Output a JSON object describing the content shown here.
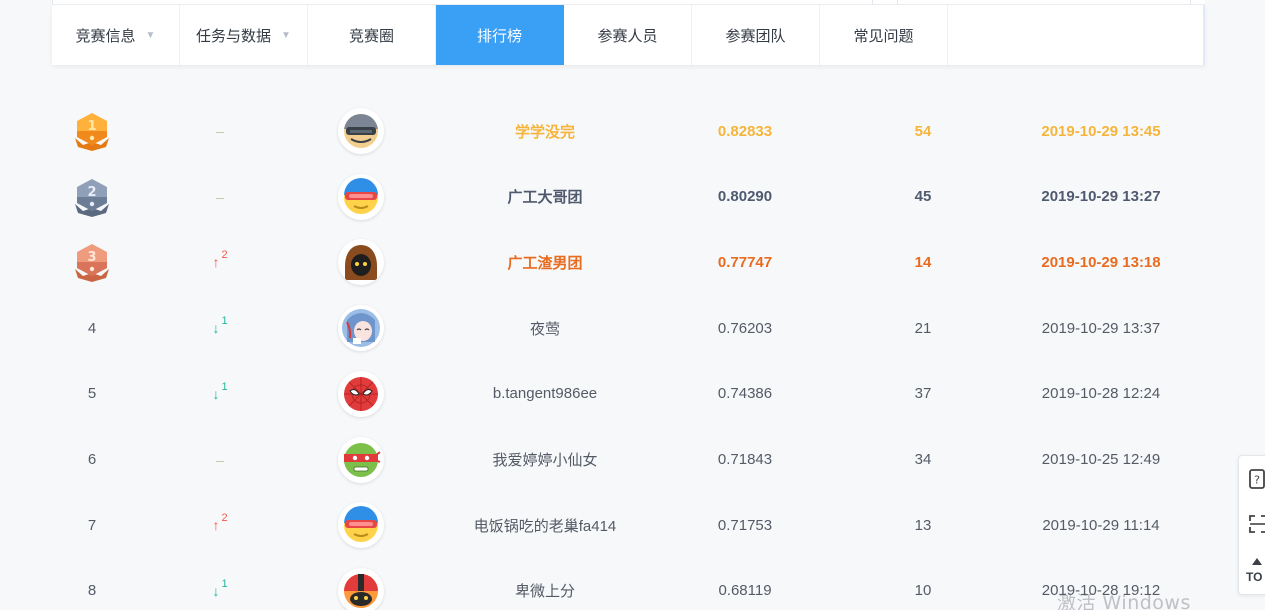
{
  "tabs": [
    {
      "label": "竞赛信息",
      "dropdown": true,
      "active": false
    },
    {
      "label": "任务与数据",
      "dropdown": true,
      "active": false
    },
    {
      "label": "竞赛圈",
      "dropdown": false,
      "active": false
    },
    {
      "label": "排行榜",
      "dropdown": false,
      "active": true
    },
    {
      "label": "参赛人员",
      "dropdown": false,
      "active": false
    },
    {
      "label": "参赛团队",
      "dropdown": false,
      "active": false
    },
    {
      "label": "常见问题",
      "dropdown": false,
      "active": false
    }
  ],
  "leaderboard": [
    {
      "rank": "1",
      "medal": "gold-medal",
      "change_dir": "same",
      "change_num": "",
      "avatar": "robocop-avatar",
      "name": "学学没完",
      "score": "0.82833",
      "count": "54",
      "time": "2019-10-29 13:45"
    },
    {
      "rank": "2",
      "medal": "silver-medal",
      "change_dir": "same",
      "change_num": "",
      "avatar": "cyclops-avatar",
      "name": "广工大哥团",
      "score": "0.80290",
      "count": "45",
      "time": "2019-10-29 13:27"
    },
    {
      "rank": "3",
      "medal": "bronze-medal",
      "change_dir": "up",
      "change_num": "2",
      "avatar": "jawa-avatar",
      "name": "广工渣男团",
      "score": "0.77747",
      "count": "14",
      "time": "2019-10-29 13:18"
    },
    {
      "rank": "4",
      "medal": "",
      "change_dir": "down",
      "change_num": "1",
      "avatar": "anime-girl-avatar",
      "name": "夜莺",
      "score": "0.76203",
      "count": "21",
      "time": "2019-10-29 13:37"
    },
    {
      "rank": "5",
      "medal": "",
      "change_dir": "down",
      "change_num": "1",
      "avatar": "spiderman-avatar",
      "name": "b.tangent986ee",
      "score": "0.74386",
      "count": "37",
      "time": "2019-10-28 12:24"
    },
    {
      "rank": "6",
      "medal": "",
      "change_dir": "same",
      "change_num": "",
      "avatar": "ninja-turtle-avatar",
      "name": "我爱婷婷小仙女",
      "score": "0.71843",
      "count": "34",
      "time": "2019-10-25 12:49"
    },
    {
      "rank": "7",
      "medal": "",
      "change_dir": "up",
      "change_num": "2",
      "avatar": "cyclops-avatar",
      "name": "电饭锅吃的老巢fa414",
      "score": "0.71753",
      "count": "13",
      "time": "2019-10-29 11:14"
    },
    {
      "rank": "8",
      "medal": "",
      "change_dir": "down",
      "change_num": "1",
      "avatar": "helmet-avatar",
      "name": "卑微上分",
      "score": "0.68119",
      "count": "10",
      "time": "2019-10-28 19:12"
    }
  ],
  "change_symbols": {
    "up": "↑",
    "down": "↓",
    "same": "–"
  },
  "sidebar": {
    "help_icon": "help-doc-icon",
    "scan_icon": "scan-icon",
    "top_label": "TO"
  },
  "watermark": "激活 Windows",
  "colors": {
    "accent": "#3aa0f5",
    "gold": "#f6b53a",
    "silver": "#4f5a6e",
    "bronze": "#e96b1f",
    "up": "#f2594b",
    "down": "#22b59a"
  }
}
